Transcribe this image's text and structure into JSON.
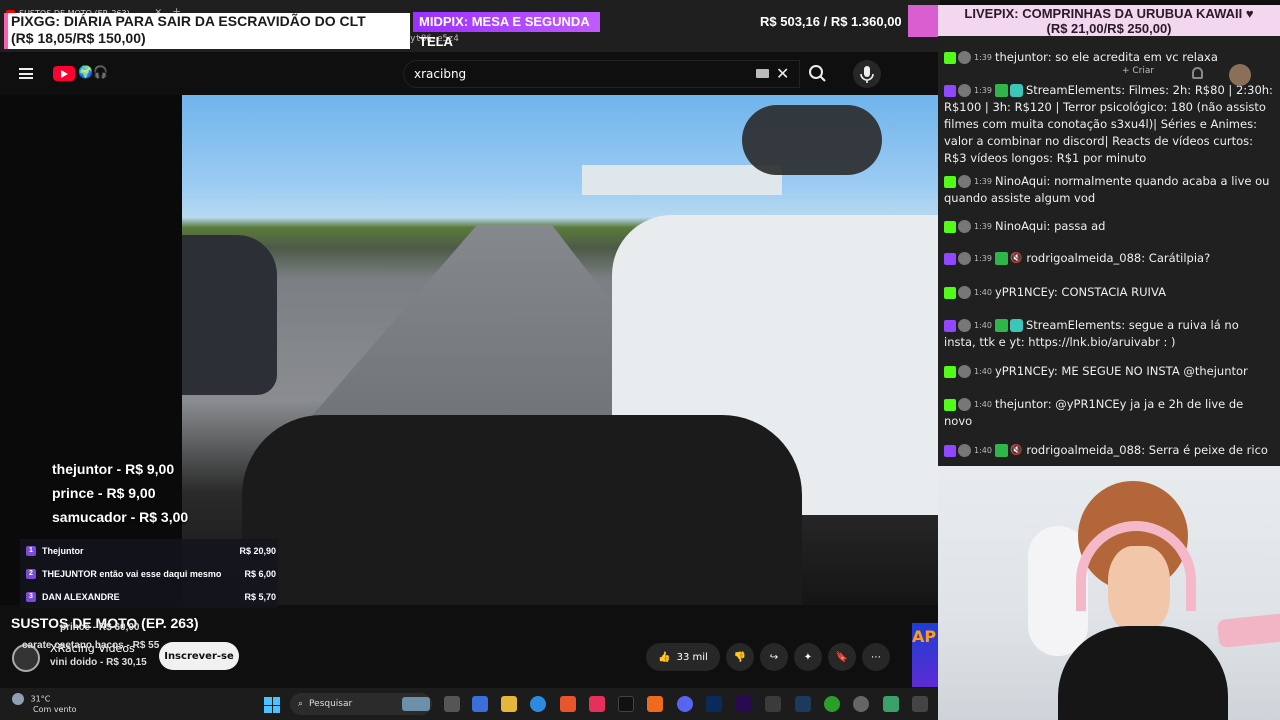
{
  "browser": {
    "tab_title": "SUSTOS DE MOTO (EP. 263)",
    "new_tab_glyph": "+",
    "url_fragment": "yt86-e5z4"
  },
  "overlays": {
    "pixgg_line1": "PIXGG: DIÁRIA PARA SAIR DA ESCRAVIDÃO DO CLT",
    "pixgg_line2": "(R$ 18,05/R$ 150,00)",
    "midpix_label": "MIDPIX: MESA E SEGUNDA TELA",
    "midpix_amount": "R$ 503,16 / R$ 1.360,00",
    "livepix_line1": "LIVEPIX: COMPRINHAS DA URUBUA KAWAII ♥",
    "livepix_line2": "(R$ 21,00/R$ 250,00)",
    "donors": [
      "thejuntor - R$ 9,00",
      "prince - R$ 9,00",
      "samucador - R$ 3,00"
    ],
    "ranking": [
      {
        "rank": "1",
        "name": "Thejuntor",
        "value": "R$ 20,90"
      },
      {
        "rank": "2",
        "name": "THEJUNTOR então vai esse daqui mesmo",
        "value": "R$ 6,00"
      },
      {
        "rank": "3",
        "name": "DAN ALEXANDRE",
        "value": "R$ 5,70"
      }
    ],
    "scroll_line1": "prince - R$ 60,00",
    "scroll_line2": "carate caetano bacos - R$ 55",
    "scroll_line3": "vini doido - R$ 30,15"
  },
  "youtube": {
    "search_value": "xracibng",
    "clear_glyph": "✕",
    "create_label": "+ Criar",
    "video_title": "SUSTOS DE MOTO (EP. 263)",
    "channel_name": "XRacing Videos",
    "subscribe_label": "Inscrever-se",
    "like_count": "33 mil",
    "more_glyph": "⋯",
    "ad_text": "AP"
  },
  "chat": [
    {
      "platform": "kick",
      "time": "1:39",
      "user": "thejuntor",
      "text": "so ele acredita em vc relaxa"
    },
    {
      "platform": "twitch",
      "time": "1:39",
      "user": "StreamElements",
      "text": "Filmes: 2h: R$80 | 2:30h: R$100 | 3h: R$120 | Terror psicológico: 180 (não assisto filmes com muita conotação s3xu4l)| Séries e Animes: valor a combinar no discord| Reacts de vídeos curtos: R$3 vídeos longos: R$1 por minuto"
    },
    {
      "platform": "kick",
      "time": "1:39",
      "user": "NinoAqui",
      "text": "normalmente quando acaba a live ou quando assiste algum vod"
    },
    {
      "platform": "kick",
      "time": "1:39",
      "user": "NinoAqui",
      "text": "passa ad"
    },
    {
      "platform": "twitch",
      "time": "1:39",
      "user": "rodrigoalmeida_088",
      "text": "Carátilpia?"
    },
    {
      "platform": "kick",
      "time": "1:40",
      "user": "yPR1NCEy",
      "text": "CONSTACIA RUIVA"
    },
    {
      "platform": "twitch",
      "time": "1:40",
      "user": "StreamElements",
      "text": "segue a ruiva lá no insta, ttk e yt: https://lnk.bio/aruivabr : )"
    },
    {
      "platform": "kick",
      "time": "1:40",
      "user": "yPR1NCEy",
      "text": "ME SEGUE NO INSTA @thejuntor"
    },
    {
      "platform": "kick",
      "time": "1:40",
      "user": "thejuntor",
      "text": "@yPR1NCEy ja ja e 2h de live de novo"
    },
    {
      "platform": "twitch",
      "time": "1:40",
      "user": "rodrigoalmeida_088",
      "text": "Serra é peixe de rico"
    }
  ],
  "taskbar": {
    "temperature": "31°C",
    "weather": "Com vento",
    "search_label": "Pesquisar"
  },
  "colors": {
    "kick_green": "#53fc18",
    "twitch_purple": "#9146ff",
    "youtube_red": "#ff0033"
  }
}
